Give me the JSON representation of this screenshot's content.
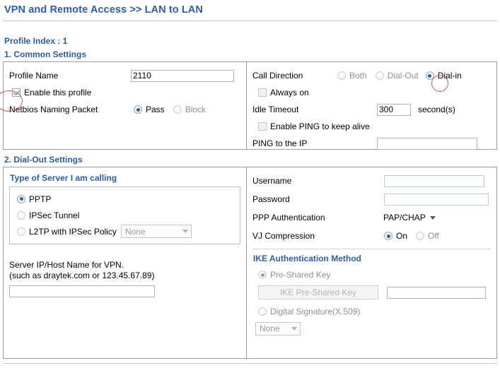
{
  "header": {
    "breadcrumb": "VPN and Remote Access >> LAN to LAN",
    "accent_color": "#2d5ca6"
  },
  "profile": {
    "index_label": "Profile Index : 1"
  },
  "common_settings": {
    "heading": "1. Common Settings",
    "profile_name": {
      "label": "Profile Name",
      "value": "2110"
    },
    "enable_profile": {
      "label": "Enable this profile",
      "checked": true,
      "annotated": true,
      "annotation_color": "#c45a5a"
    },
    "netbios": {
      "label": "Netbios Naming Packet",
      "options": [
        "Pass",
        "Block"
      ],
      "selected": "Pass"
    },
    "call_direction": {
      "label": "Call Direction",
      "options": [
        "Both",
        "Dial-Out",
        "Dial-in"
      ],
      "selected": "Dial-in",
      "annotated": true
    },
    "always_on": {
      "label": "Always on",
      "checked": false
    },
    "idle_timeout": {
      "label": "Idle Timeout",
      "value": "300",
      "unit": "second(s)"
    },
    "enable_ping": {
      "label": "Enable PING to keep alive",
      "checked": false
    },
    "ping_ip": {
      "label": "PING to the IP",
      "value": "",
      "placeholder": ""
    }
  },
  "dialout_settings": {
    "heading": "2. Dial-Out Settings",
    "server_type": {
      "title": "Type of Server I am calling",
      "options": [
        "PPTP",
        "IPSec Tunnel",
        "L2TP with IPSec Policy"
      ],
      "selected": "PPTP",
      "l2tp_policy": {
        "selected": "None",
        "disabled": true
      }
    },
    "server_host": {
      "line1": "Server IP/Host Name for VPN.",
      "line2": "(such as draytek.com or 123.45.67.89)",
      "value": ""
    },
    "username": {
      "label": "Username",
      "value": ""
    },
    "password": {
      "label": "Password",
      "value": ""
    },
    "ppp_auth": {
      "label": "PPP Authentication",
      "selected": "PAP/CHAP"
    },
    "vj_compression": {
      "label": "VJ Compression",
      "options": [
        "On",
        "Off"
      ],
      "selected": "On"
    },
    "ike_auth": {
      "title": "IKE Authentication Method",
      "pre_shared_key": {
        "label": "Pre-Shared Key",
        "selected": true,
        "disabled": true,
        "button_label": "IKE Pre-Shared Key",
        "value": ""
      },
      "digital_signature": {
        "label": "Digital Signature(X.509)",
        "selected": false,
        "disabled": true,
        "cert_selected": "None"
      }
    }
  }
}
